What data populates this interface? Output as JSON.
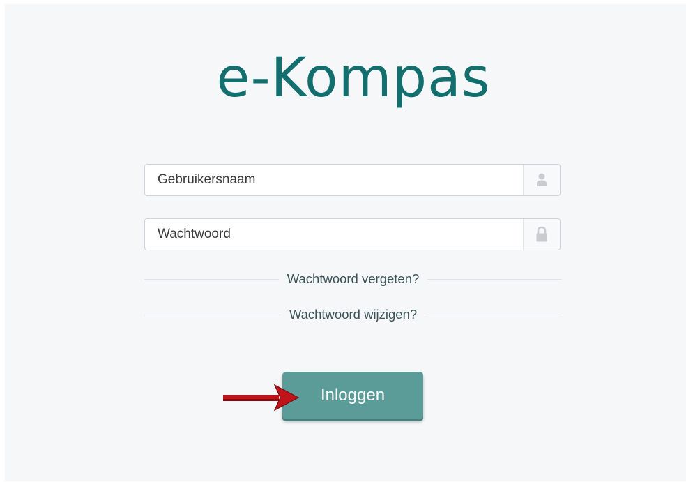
{
  "app": {
    "logo": "e-Kompas"
  },
  "login_form": {
    "username_placeholder": "Gebruikersnaam",
    "password_placeholder": "Wachtwoord",
    "forgot_password_link": "Wachtwoord vergeten?",
    "change_password_link": "Wachtwoord wijzigen?",
    "login_button": "Inloggen"
  },
  "icons": {
    "username_addon": "user-icon",
    "password_addon": "lock-icon",
    "annotation": "red-arrow-icon"
  },
  "colors": {
    "brand": "#136e6e",
    "button": "#5b9c98",
    "arrow": "#c0141b",
    "background": "#f5f7f9"
  }
}
